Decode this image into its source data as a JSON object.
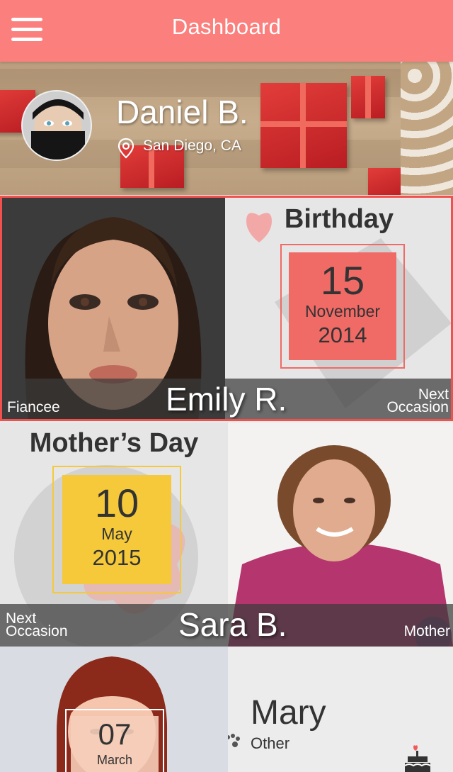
{
  "header": {
    "title": "Dashboard",
    "menu_icon": "hamburger-menu-icon"
  },
  "profile": {
    "name": "Daniel B.",
    "location": "San Diego, CA",
    "location_icon": "map-pin-icon"
  },
  "cards": [
    {
      "person": "Emily R.",
      "relation": "Fiancee",
      "event": "Birthday",
      "day": "15",
      "month": "November",
      "year": "2014",
      "next_label_line1": "Next",
      "next_label_line2": "Occasion",
      "accent": "#f06a66"
    },
    {
      "person": "Sara B.",
      "relation": "Mother",
      "event": "Mother’s Day",
      "day": "10",
      "month": "May",
      "year": "2015",
      "next_label_line1": "Next",
      "next_label_line2": "Occasion",
      "accent": "#f5c93a"
    },
    {
      "person": "Mary",
      "relation": "Other",
      "day": "07",
      "month": "March",
      "icon": "birthday-cake-icon"
    }
  ],
  "colors": {
    "topbar": "#fb7f7c",
    "selected_border": "#f0514f",
    "tile_bg": "#e6e6e6"
  }
}
